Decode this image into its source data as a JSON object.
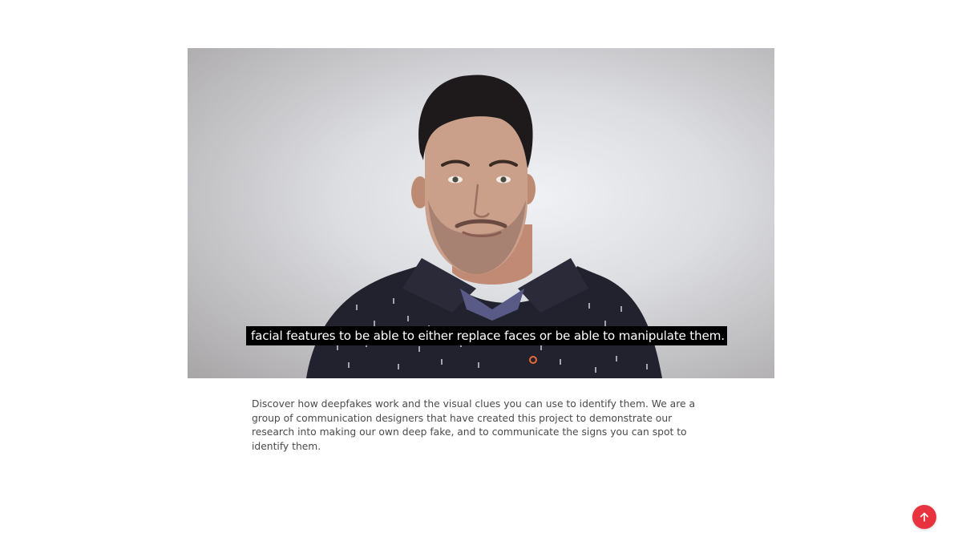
{
  "video": {
    "subtitle": "facial features to be able to either replace faces or be able to manipulate them."
  },
  "description": {
    "text": "Discover how deepfakes work and the visual clues you can use to identify them. We are a group of communication designers that have created this project to demonstrate our research into making our own deep fake, and to communicate the signs you can spot to identify them."
  },
  "scroll_top": {
    "icon": "arrow-up-icon",
    "color": "#e8323d"
  }
}
